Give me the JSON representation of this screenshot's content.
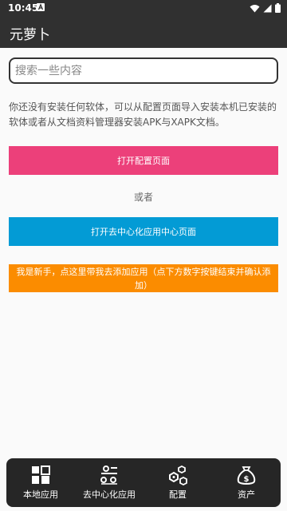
{
  "status": {
    "time": "10:45"
  },
  "app": {
    "title": "元萝卜"
  },
  "search": {
    "placeholder": "搜索一些内容"
  },
  "main": {
    "description": "你还没有安装任何软体，可以从配置页面导入安装本机已安装的软体或者从文档资料管理器安装APK与XAPK文档。",
    "open_config_label": "打开配置页面",
    "or_label": "或者",
    "open_decentral_label": "打开去中心化应用中心页面",
    "newbie_label": "我是新手，点这里带我去添加应用（点下方数字按键结束并确认添加）"
  },
  "bottom_nav": {
    "items": [
      {
        "label": "本地应用",
        "icon": "grid-icon"
      },
      {
        "label": "去中心化应用",
        "icon": "network-icon"
      },
      {
        "label": "配置",
        "icon": "hexagons-icon"
      },
      {
        "label": "资产",
        "icon": "money-bag-icon"
      }
    ]
  },
  "colors": {
    "bar": "#303030",
    "config_button": "#ec407a",
    "decentral_button": "#039bd5",
    "newbie_button": "#fb8c00",
    "bottom_nav": "#262626"
  }
}
